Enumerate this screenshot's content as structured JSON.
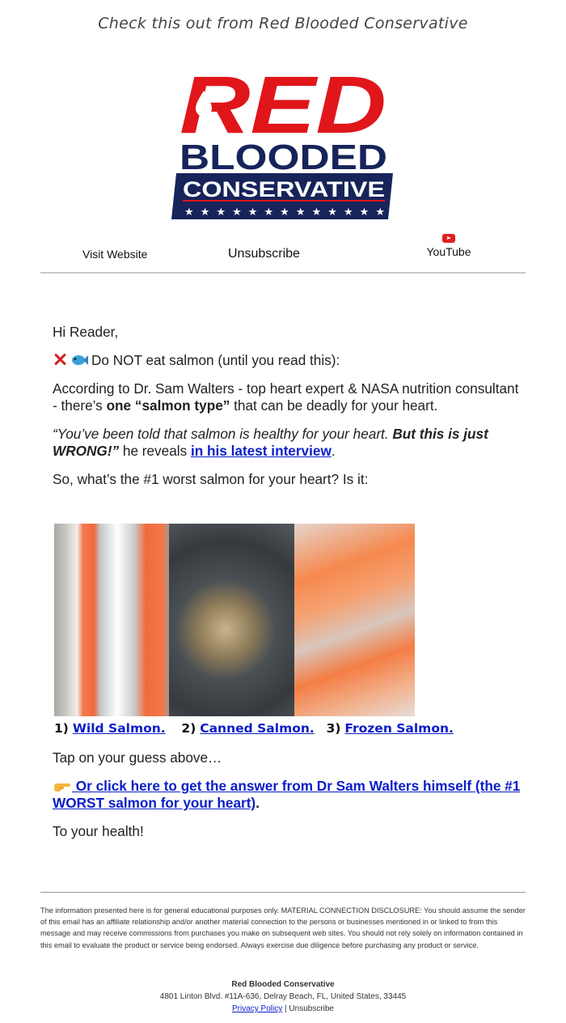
{
  "preheader": "Check this out from Red Blooded Conservative",
  "logo": {
    "line1": "RED",
    "line2": "BLOODED",
    "line3": "CONSERVATIVE",
    "colors": {
      "red": "#e0161b",
      "navy": "#16245a"
    }
  },
  "nav": {
    "visit": "Visit Website",
    "unsubscribe": "Unsubscribe",
    "youtube": "YouTube",
    "youtube_icon": "youtube-icon"
  },
  "body": {
    "greeting": "Hi Reader,",
    "headline": "Do NOT eat salmon (until you read this):",
    "para1_a": "According to Dr. Sam Walters - top heart expert & NASA nutrition consultant - there’s ",
    "para1_bold": "one “salmon type”",
    "para1_b": " that can be deadly for your heart.",
    "quote_italic": "“You’ve been told that salmon is healthy for your heart. ",
    "quote_bold": "But this is just WRONG!”",
    "quote_rest": " he reveals ",
    "quote_link": "in his latest interview",
    "quote_end": ".",
    "question": "So, what’s the #1 worst salmon for your heart? Is it:"
  },
  "options": [
    {
      "num": "1)",
      "label": "Wild Salmon."
    },
    {
      "num": "2)",
      "label": "Canned Salmon."
    },
    {
      "num": "3)",
      "label": "Frozen Salmon."
    }
  ],
  "after": {
    "tap": "Tap on your guess above…",
    "cta_link": " Or click here to get the answer from Dr Sam Walters himself (the #1 WORST salmon for your heart)",
    "cta_end": ".",
    "signoff": "To your health!"
  },
  "footer": {
    "disclaimer": "The information presented here is for general educational purposes only. MATERIAL CONNECTION DISCLOSURE: You should assume the sender of this email has an affiliate relationship and/or another material connection to the persons or businesses mentioned in or linked to from this message and may receive commissions from purchases you make on subsequent web sites. You should not rely solely on information contained in this email to evaluate the product or service being endorsed. Always exercise due diligence before purchasing any product or service.",
    "org": "Red Blooded Conservative",
    "address": "4801 Linton Blvd. #11A-636, Delray Beach, FL, United States, 33445",
    "privacy": "Privacy Policy",
    "separator": " | ",
    "unsubscribe": "Unsubscribe"
  }
}
